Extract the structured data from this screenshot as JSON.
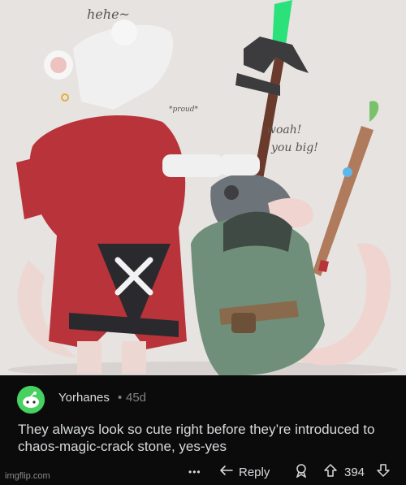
{
  "artwork": {
    "texts": {
      "hehe": "hehe~",
      "proud": "*proud*",
      "woah_line1": "woah!",
      "woah_line2": "you big!"
    },
    "colors": {
      "background": "#e7e3e0",
      "red_robe": "#b8333a",
      "green_robe": "#6f8f7a",
      "spear_tip": "#2be27a"
    }
  },
  "comment": {
    "username": "Yorhanes",
    "separator": "•",
    "age": "45d",
    "text": "They always look so cute right before they’re introduced to chaos-magic-crack stone, yes-yes",
    "actions": {
      "more": "•••",
      "reply": "Reply",
      "vote_count": "394"
    },
    "icons": [
      "avatar-icon",
      "reply-arrow-icon",
      "award-icon",
      "upvote-icon",
      "downvote-icon"
    ]
  },
  "watermark": "imgflip.com"
}
